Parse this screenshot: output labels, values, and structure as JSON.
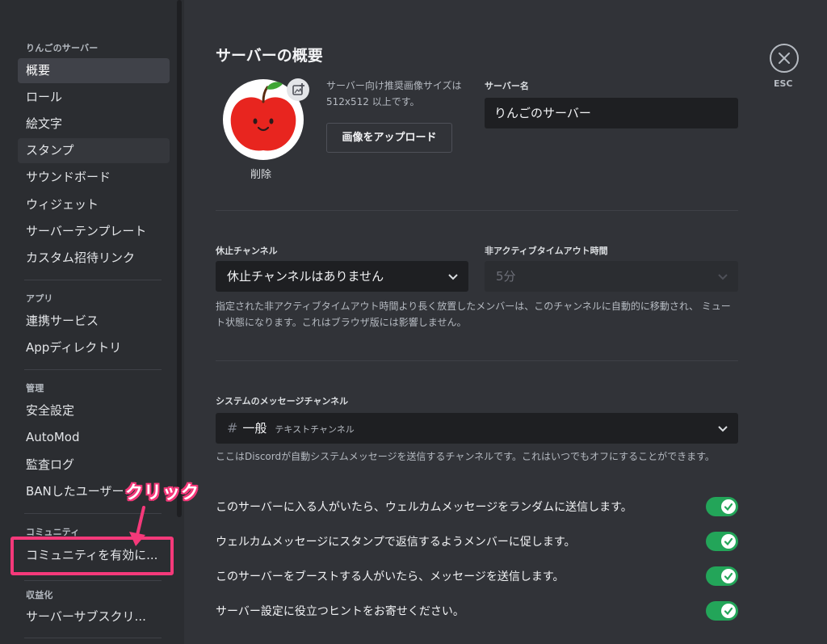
{
  "sidebar": {
    "section_server": "りんごのサーバー",
    "items_server": [
      "概要",
      "ロール",
      "絵文字",
      "スタンプ",
      "サウンドボード",
      "ウィジェット",
      "サーバーテンプレート",
      "カスタム招待リンク"
    ],
    "section_apps": "アプリ",
    "items_apps": [
      "連携サービス",
      "Appディレクトリ"
    ],
    "section_mod": "管理",
    "items_mod": [
      "安全設定",
      "AutoMod",
      "監査ログ",
      "BANしたユーザー"
    ],
    "section_community": "コミュニティ",
    "items_community": [
      "コミュニティを有効に..."
    ],
    "section_monetization": "収益化",
    "items_monetization": [
      "サーバーサブスクリ..."
    ]
  },
  "annotation": {
    "text": "クリック",
    "color": "#f5397a"
  },
  "overview": {
    "title": "サーバーの概要",
    "icon_hint": "サーバー向け推奨画像サイズは512x512 以上です。",
    "upload_button": "画像をアップロード",
    "delete_link": "削除",
    "server_name_label": "サーバー名",
    "server_name_value": "りんごのサーバー"
  },
  "afk": {
    "channel_label": "休止チャンネル",
    "channel_value": "休止チャンネルはありません",
    "timeout_label": "非アクティブタイムアウト時間",
    "timeout_value": "5分",
    "help": "指定された非アクティブタイムアウト時間より長く放置したメンバーは、このチャンネルに自動的に移動され、 ミュート状態になります。これはブラウザ版には影響しません。"
  },
  "system": {
    "label": "システムのメッセージチャンネル",
    "hash": "#",
    "channel_name": "一般",
    "channel_type": "テキストチャンネル",
    "help": "ここはDiscordが自動システムメッセージを送信するチャンネルです。これはいつでもオフにすることができます。",
    "toggles": [
      "このサーバーに入る人がいたら、ウェルカムメッセージをランダムに送信します。",
      "ウェルカムメッセージにスタンプで返信するようメンバーに促します。",
      "このサーバーをブーストする人がいたら、メッセージを送信します。",
      "サーバー設定に役立つヒントをお寄せください。"
    ],
    "toggle_color": "#23a559"
  },
  "close": {
    "label": "ESC"
  },
  "colors": {
    "background": "#313338",
    "sidebar": "#2b2d31",
    "input": "#1e1f22",
    "selected": "#404249",
    "apple_red": "#e8251f",
    "leaf_green": "#3fa535"
  }
}
